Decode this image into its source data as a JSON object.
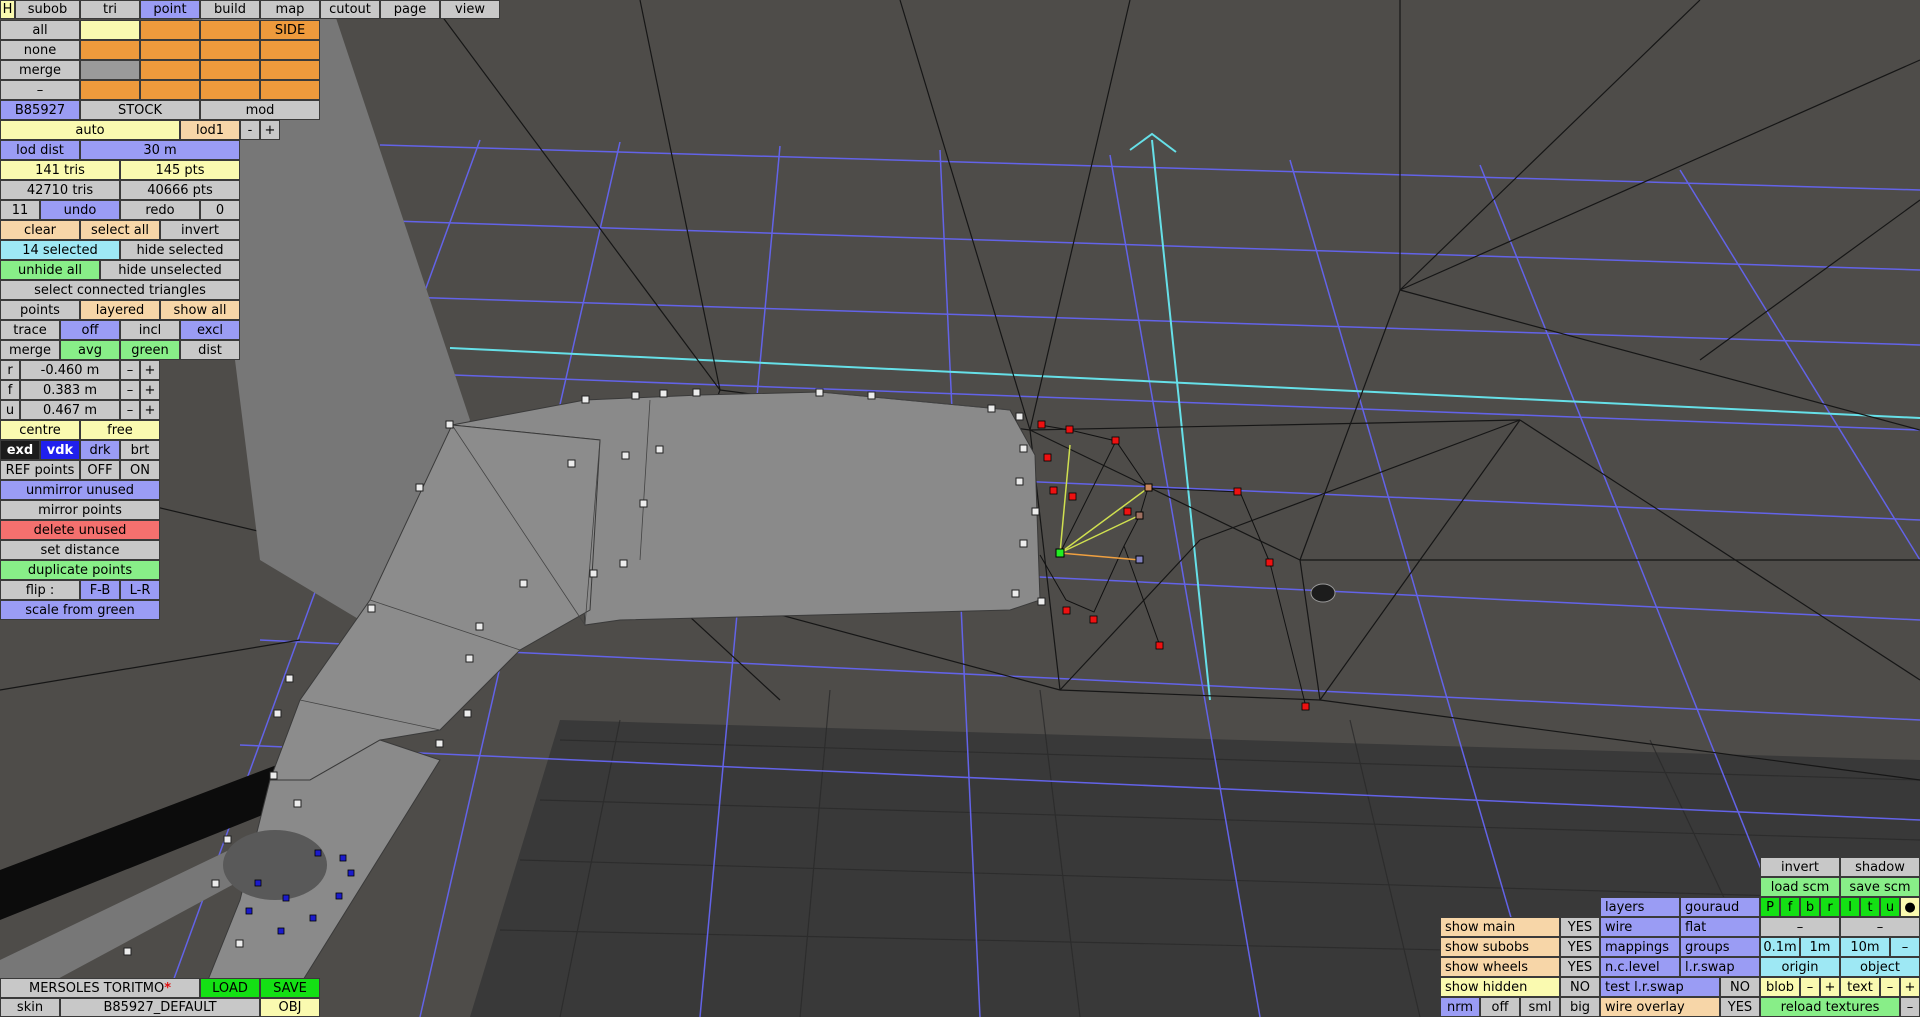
{
  "menu": {
    "h": "H",
    "tabs": [
      "subob",
      "tri",
      "point",
      "build",
      "map",
      "cutout",
      "page",
      "view"
    ],
    "active": "point"
  },
  "sel": {
    "all": "all",
    "none": "none",
    "merge": "merge",
    "dash": "–",
    "side": "SIDE"
  },
  "obj": {
    "id": "B85927",
    "stock": "STOCK",
    "mod": "mod"
  },
  "lod": {
    "auto": "auto",
    "lod1": "lod1",
    "minus": "-",
    "plus": "+",
    "dist_label": "lod dist",
    "dist_value": "30 m"
  },
  "stats": {
    "tris": "141 tris",
    "pts": "145 pts",
    "total_tris": "42710 tris",
    "total_pts": "40666 pts"
  },
  "undo": {
    "count": "11",
    "undo": "undo",
    "redo": "redo",
    "redo_count": "0"
  },
  "select": {
    "clear": "clear",
    "select_all": "select all",
    "invert": "invert",
    "selected": "14 selected",
    "hide_selected": "hide selected",
    "unhide_all": "unhide all",
    "hide_unselected": "hide unselected",
    "connected": "select connected triangles"
  },
  "view": {
    "points": "points",
    "layered": "layered",
    "show_all": "show all",
    "trace": "trace",
    "off": "off",
    "incl": "incl",
    "excl": "excl",
    "merge": "merge",
    "avg": "avg",
    "green": "green",
    "dist": "dist"
  },
  "coords": [
    {
      "axis": "r",
      "value": "-0.460 m"
    },
    {
      "axis": "f",
      "value": "0.383 m"
    },
    {
      "axis": "u",
      "value": "0.467 m"
    }
  ],
  "pm": {
    "minus": "–",
    "plus": "+"
  },
  "centre": {
    "centre": "centre",
    "free": "free"
  },
  "ref": {
    "exd": "exd",
    "vdk": "vdk",
    "drk": "drk",
    "brt": "brt",
    "ref_points": "REF points",
    "off": "OFF",
    "on": "ON"
  },
  "ops": {
    "unmirror": "unmirror unused",
    "mirror": "mirror points",
    "delete": "delete unused",
    "set_distance": "set distance",
    "duplicate": "duplicate points",
    "flip": "flip :",
    "fb": "F-B",
    "lr": "L-R",
    "scale": "scale from green"
  },
  "bottom": {
    "name": "MERSOLES TORITMO",
    "asterisk": "*",
    "load": "LOAD",
    "save": "SAVE",
    "skin": "skin",
    "skin_name": "B85927_DEFAULT",
    "obj": "OBJ"
  },
  "right": {
    "invert": "invert",
    "shadow": "shadow",
    "load_scm": "load scm",
    "save_scm": "save scm",
    "layers": "layers",
    "gouraud": "gouraud",
    "letters": [
      "P",
      "f",
      "b",
      "r",
      "l",
      "t",
      "u",
      "●"
    ],
    "wire": "wire",
    "flat": "flat",
    "dash": "–",
    "mappings": "mappings",
    "groups": "groups",
    "d01": "0.1m",
    "d1": "1m",
    "d10": "10m",
    "nclevel": "n.c.level",
    "lrswap": "l.r.swap",
    "origin": "origin",
    "object": "object",
    "test_lrswap": "test l.r.swap",
    "no": "NO",
    "blob": "blob",
    "text": "text",
    "plus": "+",
    "minus": "–",
    "wire_overlay": "wire overlay",
    "yes": "YES",
    "reload": "reload textures",
    "show_main": "show main",
    "show_subobs": "show subobs",
    "show_wheels": "show wheels",
    "show_hidden": "show hidden",
    "show_main_v": "YES",
    "show_subobs_v": "YES",
    "show_wheels_v": "YES",
    "show_hidden_v": "NO",
    "nrm": "nrm",
    "off": "off",
    "sml": "sml",
    "big": "big"
  }
}
